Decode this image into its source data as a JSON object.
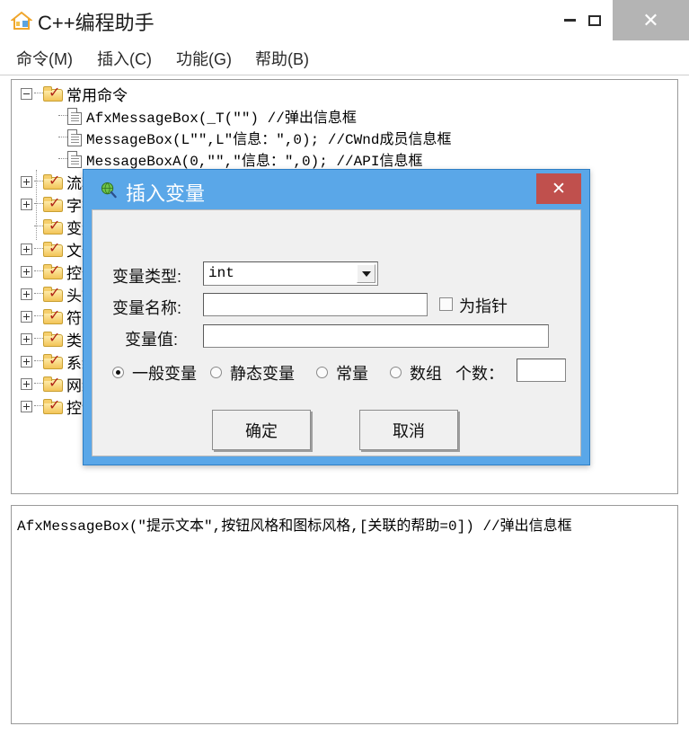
{
  "window": {
    "title": "C++编程助手",
    "icon": "house-icon",
    "controls": {
      "minimize": "minimize-icon",
      "maximize": "maximize-icon",
      "close": "✕"
    }
  },
  "menu": {
    "items": [
      {
        "label": "命令(M)",
        "name": "menu-command"
      },
      {
        "label": "插入(C)",
        "name": "menu-insert"
      },
      {
        "label": "功能(G)",
        "name": "menu-function"
      },
      {
        "label": "帮助(B)",
        "name": "menu-help"
      }
    ]
  },
  "tree": {
    "nodes": [
      {
        "label": "常用命令",
        "kind": "folder",
        "expanded": true,
        "expander": "minus",
        "indent": 0
      },
      {
        "label": "AfxMessageBox(_T(\"\")  //弹出信息框",
        "kind": "doc",
        "indent": 1
      },
      {
        "label": "MessageBox(L\"\",L\"信息：\",0);  //CWnd成员信息框",
        "kind": "doc",
        "indent": 1
      },
      {
        "label": "MessageBoxA(0,\"\",\"信息：\",0);  //API信息框",
        "kind": "doc",
        "indent": 1
      },
      {
        "label": "流程控制",
        "kind": "folder",
        "expanded": false,
        "expander": "plus",
        "indent": 0
      },
      {
        "label": "字符串",
        "kind": "folder",
        "expanded": false,
        "expander": "plus",
        "indent": 0
      },
      {
        "label": "变量",
        "kind": "folder",
        "expanded": false,
        "expander": "none",
        "indent": 0
      },
      {
        "label": "文件",
        "kind": "folder",
        "expanded": false,
        "expander": "plus",
        "indent": 0
      },
      {
        "label": "控件",
        "kind": "folder",
        "expanded": false,
        "expander": "plus",
        "indent": 0
      },
      {
        "label": "头文件",
        "kind": "folder",
        "expanded": false,
        "expander": "plus",
        "indent": 0
      },
      {
        "label": "符号",
        "kind": "folder",
        "expanded": false,
        "expander": "plus",
        "indent": 0
      },
      {
        "label": "类",
        "kind": "folder",
        "expanded": false,
        "expander": "plus",
        "indent": 0
      },
      {
        "label": "系统",
        "kind": "folder",
        "expanded": false,
        "expander": "plus",
        "indent": 0
      },
      {
        "label": "网络",
        "kind": "folder",
        "expanded": false,
        "expander": "plus",
        "indent": 0
      },
      {
        "label": "控制台",
        "kind": "folder",
        "expanded": false,
        "expander": "plus",
        "indent": 0
      }
    ]
  },
  "output": {
    "text": "AfxMessageBox(\"提示文本\",按钮风格和图标风格,[关联的帮助=0]) //弹出信息框"
  },
  "dialog": {
    "title": "插入变量",
    "icon": "globe-search-icon",
    "close_label": "✕",
    "close_color": "#c0504d",
    "titlebar_color": "#5aa7e8",
    "fields": {
      "type_label": "变量类型:",
      "type_value": "int",
      "name_label": "变量名称:",
      "name_value": "",
      "value_label": "变量值:",
      "value_value": "",
      "pointer_label": "为指针",
      "pointer_checked": false,
      "count_label": "个数：",
      "count_value": ""
    },
    "radios": [
      {
        "label": "一般变量",
        "checked": true
      },
      {
        "label": "静态变量",
        "checked": false
      },
      {
        "label": "常量",
        "checked": false
      },
      {
        "label": "数组",
        "checked": false
      }
    ],
    "buttons": {
      "ok": "确定",
      "cancel": "取消"
    }
  }
}
